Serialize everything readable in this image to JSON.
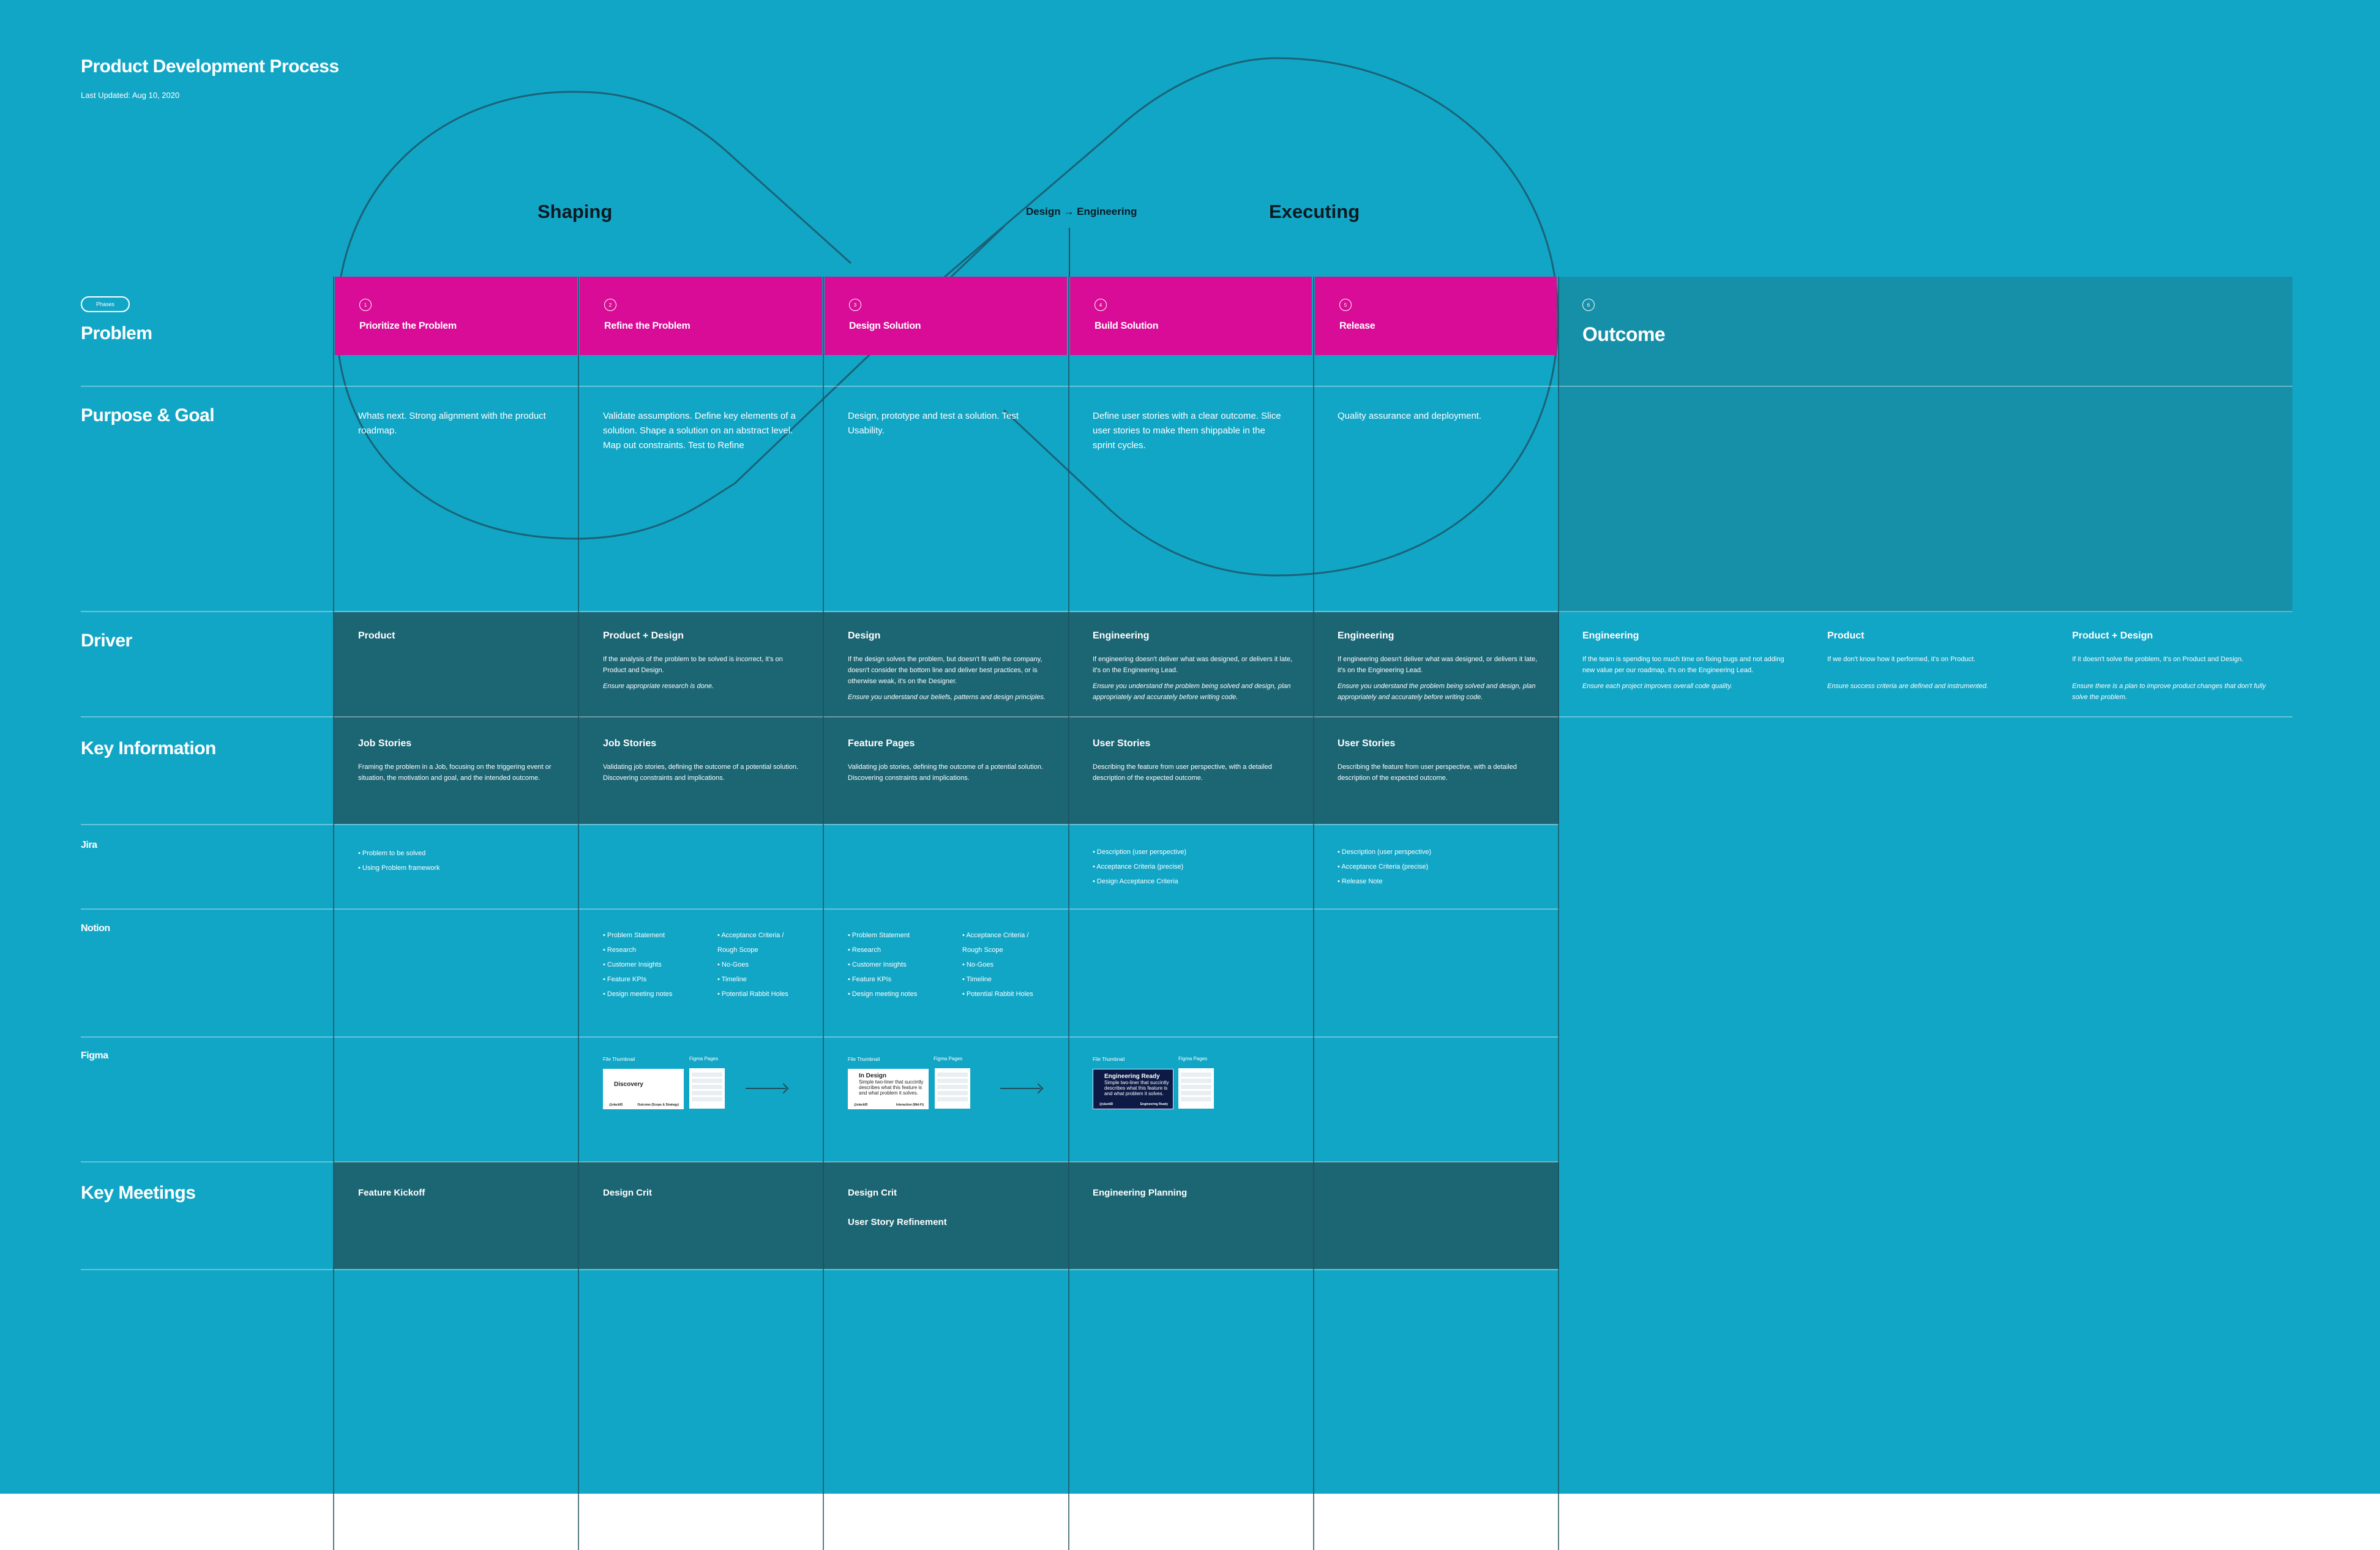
{
  "header": {
    "title": "Product Development Process",
    "last_updated": "Last Updated: Aug 10, 2020"
  },
  "stages": {
    "shaping": "Shaping",
    "handoff": "Design → Engineering",
    "executing": "Executing"
  },
  "phases_pill": "Phases",
  "row_labels": {
    "problem": "Problem",
    "purpose": "Purpose & Goal",
    "driver": "Driver",
    "key_info": "Key Information",
    "jira": "Jira",
    "notion": "Notion",
    "figma": "Figma",
    "meetings": "Key Meetings"
  },
  "phases": [
    {
      "num": "1",
      "name": "Prioritize the Problem"
    },
    {
      "num": "2",
      "name": "Refine the Problem"
    },
    {
      "num": "3",
      "name": "Design Solution"
    },
    {
      "num": "4",
      "name": "Build Solution"
    },
    {
      "num": "5",
      "name": "Release"
    }
  ],
  "outcome": {
    "num": "6",
    "name": "Outcome"
  },
  "purpose": [
    "Whats next. Strong alignment with the product roadmap.",
    "Validate assumptions. Define key elements of a solution. Shape a solution on an abstract level. Map out constraints. Test to Refine",
    "Design, prototype and test a solution. Test Usability.",
    "Define user stories with a clear outcome. Slice user stories to make them shippable in the sprint cycles.",
    "Quality assurance and deployment."
  ],
  "drivers": [
    {
      "head": "Product",
      "body": "",
      "note": ""
    },
    {
      "head": "Product + Design",
      "body": "If the analysis of the problem to be solved is incorrect, it's on Product and Design.",
      "note": "Ensure appropriate research is done."
    },
    {
      "head": "Design",
      "body": "If the design solves the problem, but doesn't fit with the company, doesn't consider the bottom line and deliver best practices, or is otherwise weak, it's on the Designer.",
      "note": "Ensure you understand our beliefs, patterns and design principles."
    },
    {
      "head": "Engineering",
      "body": "If engineering doesn't deliver what was designed, or delivers it late, it's on the Engineering Lead.",
      "note": "Ensure you understand the problem being solved and design, plan appropriately and accurately before writing code."
    },
    {
      "head": "Engineering",
      "body": "If engineering doesn't deliver what was designed, or delivers it late, it's on the Engineering Lead.",
      "note": "Ensure you understand the problem being solved and design, plan appropriately and accurately before writing code."
    }
  ],
  "outcome_drivers": [
    {
      "head": "Engineering",
      "body": "If the team is spending too much time on fixing bugs and not adding new value per our roadmap, it's on the Engineering Lead.",
      "note": "Ensure each project improves overall code quality."
    },
    {
      "head": "Product",
      "body": "If we don't know how it performed, it's on Product.",
      "note": "Ensure success criteria are defined and instrumented."
    },
    {
      "head": "Product + Design",
      "body": "If it doesn't solve the problem, it's on Product and Design.",
      "note": "Ensure there is a plan to improve product changes that don't fully solve the problem."
    }
  ],
  "key_info": [
    {
      "head": "Job Stories",
      "body": "Framing the problem in a Job, focusing on the triggering event or situation, the motivation and goal, and the intended outcome."
    },
    {
      "head": "Job Stories",
      "body": "Validating job stories, defining the outcome of a potential solution. Discovering constraints and implications."
    },
    {
      "head": "Feature Pages",
      "body": "Validating job stories, defining the outcome of a potential solution. Discovering constraints and implications."
    },
    {
      "head": "User Stories",
      "body": "Describing the feature from user perspective, with a detailed description of the expected outcome."
    },
    {
      "head": "User Stories",
      "body": "Describing the feature from user perspective, with a detailed description of the expected outcome."
    }
  ],
  "jira": {
    "col1": [
      "Problem to be solved",
      "Using Problem framework"
    ],
    "col4": [
      "Description (user perspective)",
      "Acceptance Criteria (precise)",
      "Design Acceptance Criteria"
    ],
    "col5": [
      "Description (user perspective)",
      "Acceptance Criteria (precise)",
      "Release Note"
    ]
  },
  "notion": {
    "left": [
      "Problem Statement",
      "Research",
      "Customer Insights",
      "Feature KPIs",
      "Design meeting notes"
    ],
    "right": [
      "Acceptance Criteria / Rough Scope",
      "No-Goes",
      "Timeline",
      "Potential Rabbit Holes"
    ]
  },
  "figma": {
    "thumb_label": "File Thumbnail",
    "pages_label": "Figma Pages",
    "thumbs": [
      {
        "title": "Discovery",
        "body": "",
        "owner": "@slackID",
        "status": "Outcome (Scope & Strategy)"
      },
      {
        "title": "In Design",
        "body": "Simple two-liner that succintly describes what this feature is and what problem it solves.",
        "owner": "@slackID",
        "status": "Interaction (Mid-Fi)"
      },
      {
        "title": "Engineering Ready",
        "body": "Simple two-liner that succintly describes what this feature is and what problem it solves.",
        "owner": "@slackID",
        "status": "Engineering Ready"
      }
    ]
  },
  "meetings": [
    [
      "Feature Kickoff"
    ],
    [
      "Design Crit"
    ],
    [
      "Design Crit",
      "User Story Refinement"
    ],
    [
      "Engineering Planning"
    ],
    []
  ]
}
